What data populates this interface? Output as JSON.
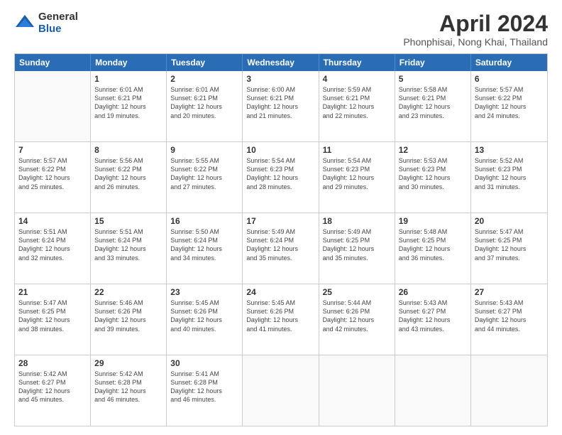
{
  "logo": {
    "general": "General",
    "blue": "Blue"
  },
  "title": "April 2024",
  "subtitle": "Phonphisai, Nong Khai, Thailand",
  "header_days": [
    "Sunday",
    "Monday",
    "Tuesday",
    "Wednesday",
    "Thursday",
    "Friday",
    "Saturday"
  ],
  "rows": [
    [
      {
        "day": "",
        "info": ""
      },
      {
        "day": "1",
        "info": "Sunrise: 6:01 AM\nSunset: 6:21 PM\nDaylight: 12 hours\nand 19 minutes."
      },
      {
        "day": "2",
        "info": "Sunrise: 6:01 AM\nSunset: 6:21 PM\nDaylight: 12 hours\nand 20 minutes."
      },
      {
        "day": "3",
        "info": "Sunrise: 6:00 AM\nSunset: 6:21 PM\nDaylight: 12 hours\nand 21 minutes."
      },
      {
        "day": "4",
        "info": "Sunrise: 5:59 AM\nSunset: 6:21 PM\nDaylight: 12 hours\nand 22 minutes."
      },
      {
        "day": "5",
        "info": "Sunrise: 5:58 AM\nSunset: 6:21 PM\nDaylight: 12 hours\nand 23 minutes."
      },
      {
        "day": "6",
        "info": "Sunrise: 5:57 AM\nSunset: 6:22 PM\nDaylight: 12 hours\nand 24 minutes."
      }
    ],
    [
      {
        "day": "7",
        "info": "Sunrise: 5:57 AM\nSunset: 6:22 PM\nDaylight: 12 hours\nand 25 minutes."
      },
      {
        "day": "8",
        "info": "Sunrise: 5:56 AM\nSunset: 6:22 PM\nDaylight: 12 hours\nand 26 minutes."
      },
      {
        "day": "9",
        "info": "Sunrise: 5:55 AM\nSunset: 6:22 PM\nDaylight: 12 hours\nand 27 minutes."
      },
      {
        "day": "10",
        "info": "Sunrise: 5:54 AM\nSunset: 6:23 PM\nDaylight: 12 hours\nand 28 minutes."
      },
      {
        "day": "11",
        "info": "Sunrise: 5:54 AM\nSunset: 6:23 PM\nDaylight: 12 hours\nand 29 minutes."
      },
      {
        "day": "12",
        "info": "Sunrise: 5:53 AM\nSunset: 6:23 PM\nDaylight: 12 hours\nand 30 minutes."
      },
      {
        "day": "13",
        "info": "Sunrise: 5:52 AM\nSunset: 6:23 PM\nDaylight: 12 hours\nand 31 minutes."
      }
    ],
    [
      {
        "day": "14",
        "info": "Sunrise: 5:51 AM\nSunset: 6:24 PM\nDaylight: 12 hours\nand 32 minutes."
      },
      {
        "day": "15",
        "info": "Sunrise: 5:51 AM\nSunset: 6:24 PM\nDaylight: 12 hours\nand 33 minutes."
      },
      {
        "day": "16",
        "info": "Sunrise: 5:50 AM\nSunset: 6:24 PM\nDaylight: 12 hours\nand 34 minutes."
      },
      {
        "day": "17",
        "info": "Sunrise: 5:49 AM\nSunset: 6:24 PM\nDaylight: 12 hours\nand 35 minutes."
      },
      {
        "day": "18",
        "info": "Sunrise: 5:49 AM\nSunset: 6:25 PM\nDaylight: 12 hours\nand 35 minutes."
      },
      {
        "day": "19",
        "info": "Sunrise: 5:48 AM\nSunset: 6:25 PM\nDaylight: 12 hours\nand 36 minutes."
      },
      {
        "day": "20",
        "info": "Sunrise: 5:47 AM\nSunset: 6:25 PM\nDaylight: 12 hours\nand 37 minutes."
      }
    ],
    [
      {
        "day": "21",
        "info": "Sunrise: 5:47 AM\nSunset: 6:25 PM\nDaylight: 12 hours\nand 38 minutes."
      },
      {
        "day": "22",
        "info": "Sunrise: 5:46 AM\nSunset: 6:26 PM\nDaylight: 12 hours\nand 39 minutes."
      },
      {
        "day": "23",
        "info": "Sunrise: 5:45 AM\nSunset: 6:26 PM\nDaylight: 12 hours\nand 40 minutes."
      },
      {
        "day": "24",
        "info": "Sunrise: 5:45 AM\nSunset: 6:26 PM\nDaylight: 12 hours\nand 41 minutes."
      },
      {
        "day": "25",
        "info": "Sunrise: 5:44 AM\nSunset: 6:26 PM\nDaylight: 12 hours\nand 42 minutes."
      },
      {
        "day": "26",
        "info": "Sunrise: 5:43 AM\nSunset: 6:27 PM\nDaylight: 12 hours\nand 43 minutes."
      },
      {
        "day": "27",
        "info": "Sunrise: 5:43 AM\nSunset: 6:27 PM\nDaylight: 12 hours\nand 44 minutes."
      }
    ],
    [
      {
        "day": "28",
        "info": "Sunrise: 5:42 AM\nSunset: 6:27 PM\nDaylight: 12 hours\nand 45 minutes."
      },
      {
        "day": "29",
        "info": "Sunrise: 5:42 AM\nSunset: 6:28 PM\nDaylight: 12 hours\nand 46 minutes."
      },
      {
        "day": "30",
        "info": "Sunrise: 5:41 AM\nSunset: 6:28 PM\nDaylight: 12 hours\nand 46 minutes."
      },
      {
        "day": "",
        "info": ""
      },
      {
        "day": "",
        "info": ""
      },
      {
        "day": "",
        "info": ""
      },
      {
        "day": "",
        "info": ""
      }
    ]
  ]
}
